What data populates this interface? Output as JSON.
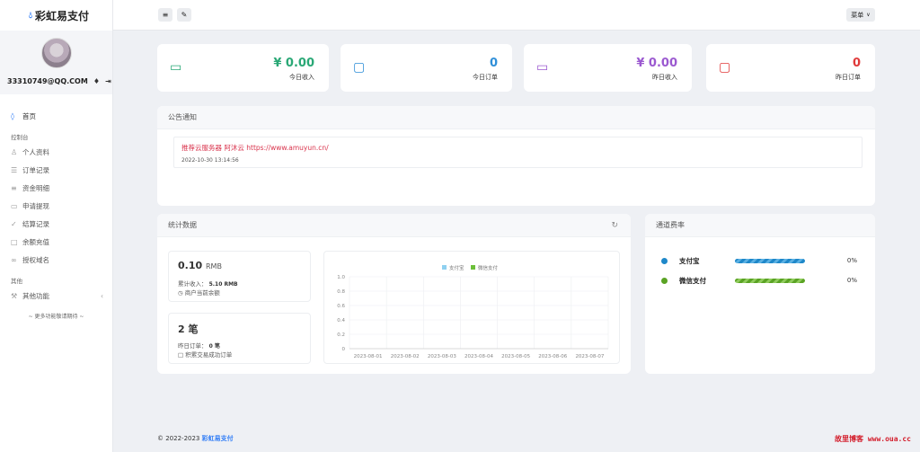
{
  "brand": {
    "name": "彩虹易支付"
  },
  "profile": {
    "email": "33310749@QQ.COM"
  },
  "sidebar": {
    "home": "首页",
    "section_console": "控制台",
    "items": [
      {
        "label": "个人资料",
        "icon": "user-icon"
      },
      {
        "label": "订单记录",
        "icon": "list-icon"
      },
      {
        "label": "资金明细",
        "icon": "list-detail-icon"
      },
      {
        "label": "申请提现",
        "icon": "card-icon"
      },
      {
        "label": "结算记录",
        "icon": "check-circle-icon"
      },
      {
        "label": "余额充值",
        "icon": "calendar-icon"
      },
      {
        "label": "授权域名",
        "icon": "link-icon"
      }
    ],
    "section_other": "其他",
    "other_item": "其他功能",
    "more": "~ 更多功能敬请期待 ~"
  },
  "topbar": {
    "menu_label": "菜单"
  },
  "stats": [
    {
      "value": "¥ 0.00",
      "label": "今日收入",
      "color": "#2aa876"
    },
    {
      "value": "0",
      "label": "今日订单",
      "color": "#2f8fd8"
    },
    {
      "value": "¥ 0.00",
      "label": "昨日收入",
      "color": "#9b59d0"
    },
    {
      "value": "0",
      "label": "昨日订单",
      "color": "#e03a3a"
    }
  ],
  "notice": {
    "title": "公告通知",
    "text": "推荐云服务器 阿沐云 https://www.amuyun.cn/",
    "time": "2022-10-30 13:14:56"
  },
  "stats_panel": {
    "title": "统计数据",
    "balance_value": "0.10",
    "balance_unit": "RMB",
    "total_income_label": "累计收入：",
    "total_income_value": "5.10 RMB",
    "balance_label": "商户当前余额",
    "orders_value": "2",
    "orders_unit": "笔",
    "yesterday_orders_label": "昨日订单：",
    "yesterday_orders_value": "0 笔",
    "orders_desc": "积累交易成功订单"
  },
  "chart_data": {
    "type": "bar",
    "categories": [
      "2023-08-01",
      "2023-08-02",
      "2023-08-03",
      "2023-08-04",
      "2023-08-05",
      "2023-08-06",
      "2023-08-07"
    ],
    "series": [
      {
        "name": "支付宝",
        "values": [
          0,
          0,
          0,
          0,
          0,
          0,
          0
        ],
        "color": "#8fd0f0"
      },
      {
        "name": "微信支付",
        "values": [
          0,
          0,
          0,
          0,
          0,
          0,
          0
        ],
        "color": "#6cbf3a"
      }
    ],
    "yticks": [
      "0",
      "0.2",
      "0.4",
      "0.6",
      "0.8",
      "1.0"
    ],
    "ylim": [
      0,
      1.0
    ],
    "legend": "top-center"
  },
  "channels": {
    "title": "通道费率",
    "items": [
      {
        "name": "支付宝",
        "pct": "0%",
        "color": "#1f88c9"
      },
      {
        "name": "微信支付",
        "pct": "0%",
        "color": "#5aa324"
      }
    ]
  },
  "footer": {
    "copyright": "© 2022-2023",
    "brand": "彩虹易支付"
  },
  "watermark": "故里博客 www.oua.cc"
}
